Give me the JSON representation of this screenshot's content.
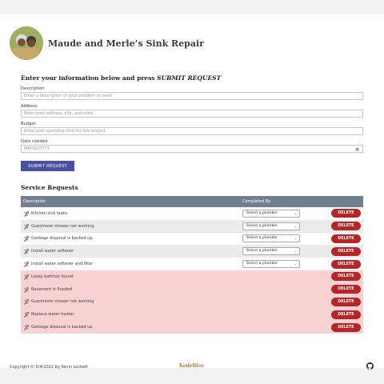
{
  "header": {
    "title": "Maude and Merle’s Sink Repair"
  },
  "form": {
    "intro_prefix": "Enter your information below and press ",
    "intro_emphasis": "SUBMIT REQUEST",
    "description_label": "Description",
    "description_placeholder": "Enter a description of your problem or need",
    "address_label": "Address",
    "address_placeholder": "Enter your address, city, and state",
    "budget_label": "Budget",
    "budget_placeholder": "Enter your spending limit for this project",
    "date_label": "Date needed",
    "date_placeholder": "MM/DD/YYYY",
    "submit_label": "SUBMIT REQUEST"
  },
  "requests": {
    "title": "Service Requests",
    "col_description": "Description",
    "col_completed": "Completed By",
    "select_placeholder": "Select a plumber",
    "delete_label": "DELETE",
    "rows": [
      {
        "description": "Kitchen sink leaks",
        "completed": false
      },
      {
        "description": "Guestroom shower not working",
        "completed": false
      },
      {
        "description": "Garbage disposal is backed up",
        "completed": false
      },
      {
        "description": "Install water softener",
        "completed": false
      },
      {
        "description": "Install water softener and filter",
        "completed": false
      },
      {
        "description": "Leaky bathtub faucet",
        "completed": true
      },
      {
        "description": "Basement is flooded",
        "completed": true
      },
      {
        "description": "Guestroom shower not working",
        "completed": true
      },
      {
        "description": "Replace water heater",
        "completed": true
      },
      {
        "description": "Garbage disposal is backed up",
        "completed": true
      }
    ]
  },
  "footer": {
    "copyright": "Copyright © 5/4/2022 by Kevin Lockett",
    "logo_text": "KodeBlox"
  },
  "icons": {
    "row_icon": "wrench-icon",
    "calendar": "calendar-icon",
    "github": "github-icon"
  },
  "colors": {
    "accent": "#4a4fa0",
    "delete": "#b52626",
    "header_row": "#6f7f8f",
    "completed_row": "#f8d2d2"
  }
}
